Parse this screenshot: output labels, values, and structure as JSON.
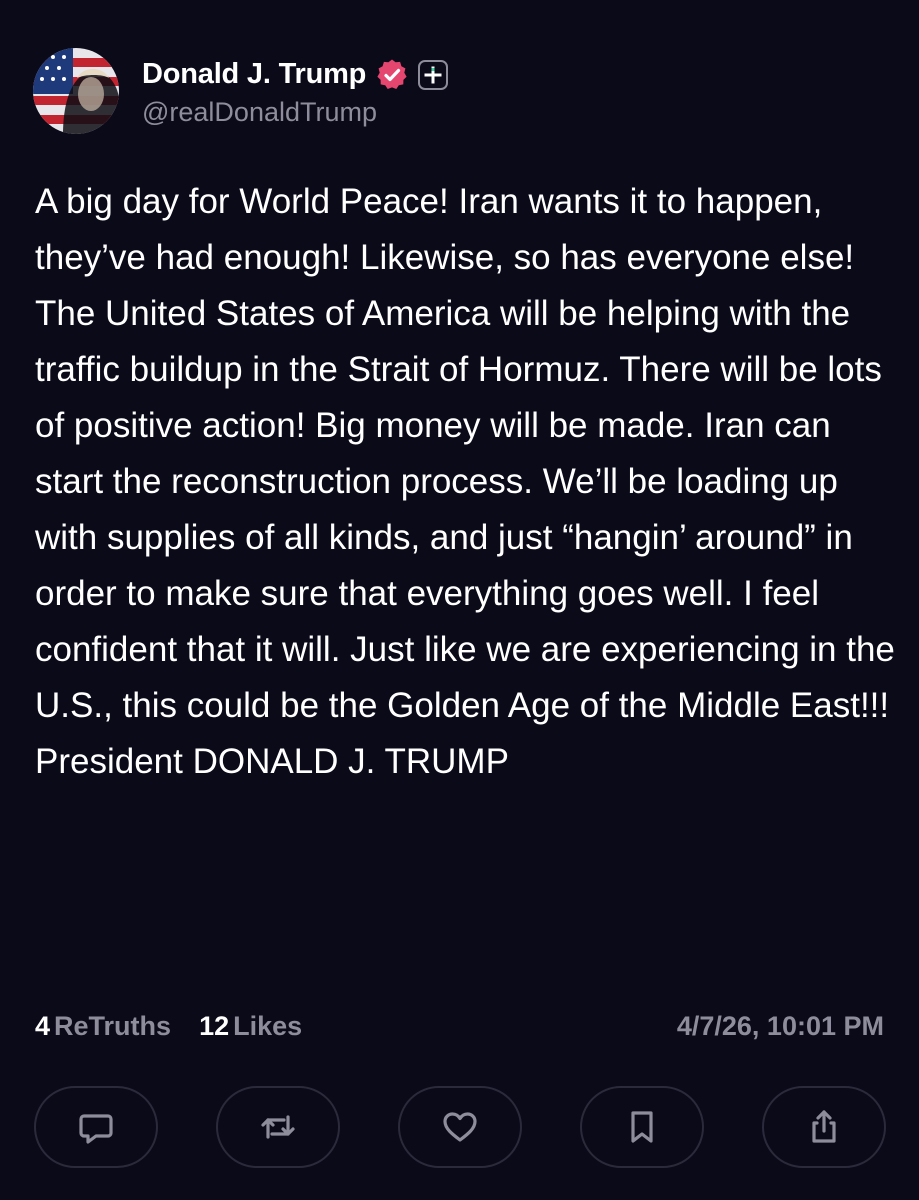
{
  "author": {
    "display_name": "Donald J. Trump",
    "handle": "@realDonaldTrump"
  },
  "post": {
    "text": "A big day for World Peace! Iran wants it to happen, they’ve had enough! Likewise, so has everyone else! The United States of America will be helping with the traffic buildup in the Strait of Hormuz. There will be lots of positive action! Big money will be made. Iran can start the reconstruction process. We’ll be loading up with supplies of all kinds, and just “hangin’ around” in order to make sure that everything goes well. I feel confident that it will. Just like we are experiencing in the U.S., this could be the Golden Age of the Middle East!!! President DONALD J. TRUMP"
  },
  "stats": {
    "retruths_count": "4",
    "retruths_label": "ReTruths",
    "likes_count": "12",
    "likes_label": "Likes"
  },
  "timestamp": "4/7/26, 10:01 PM",
  "actions": [
    {
      "icon": "comment-icon"
    },
    {
      "icon": "retruth-icon"
    },
    {
      "icon": "heart-icon"
    },
    {
      "icon": "bookmark-icon"
    },
    {
      "icon": "share-icon"
    }
  ],
  "colors": {
    "background": "#0b0a19",
    "text_primary": "#ffffff",
    "text_secondary": "#8e8d9b",
    "verified_badge": "#e5466f",
    "button_border": "#2b2a3b"
  }
}
